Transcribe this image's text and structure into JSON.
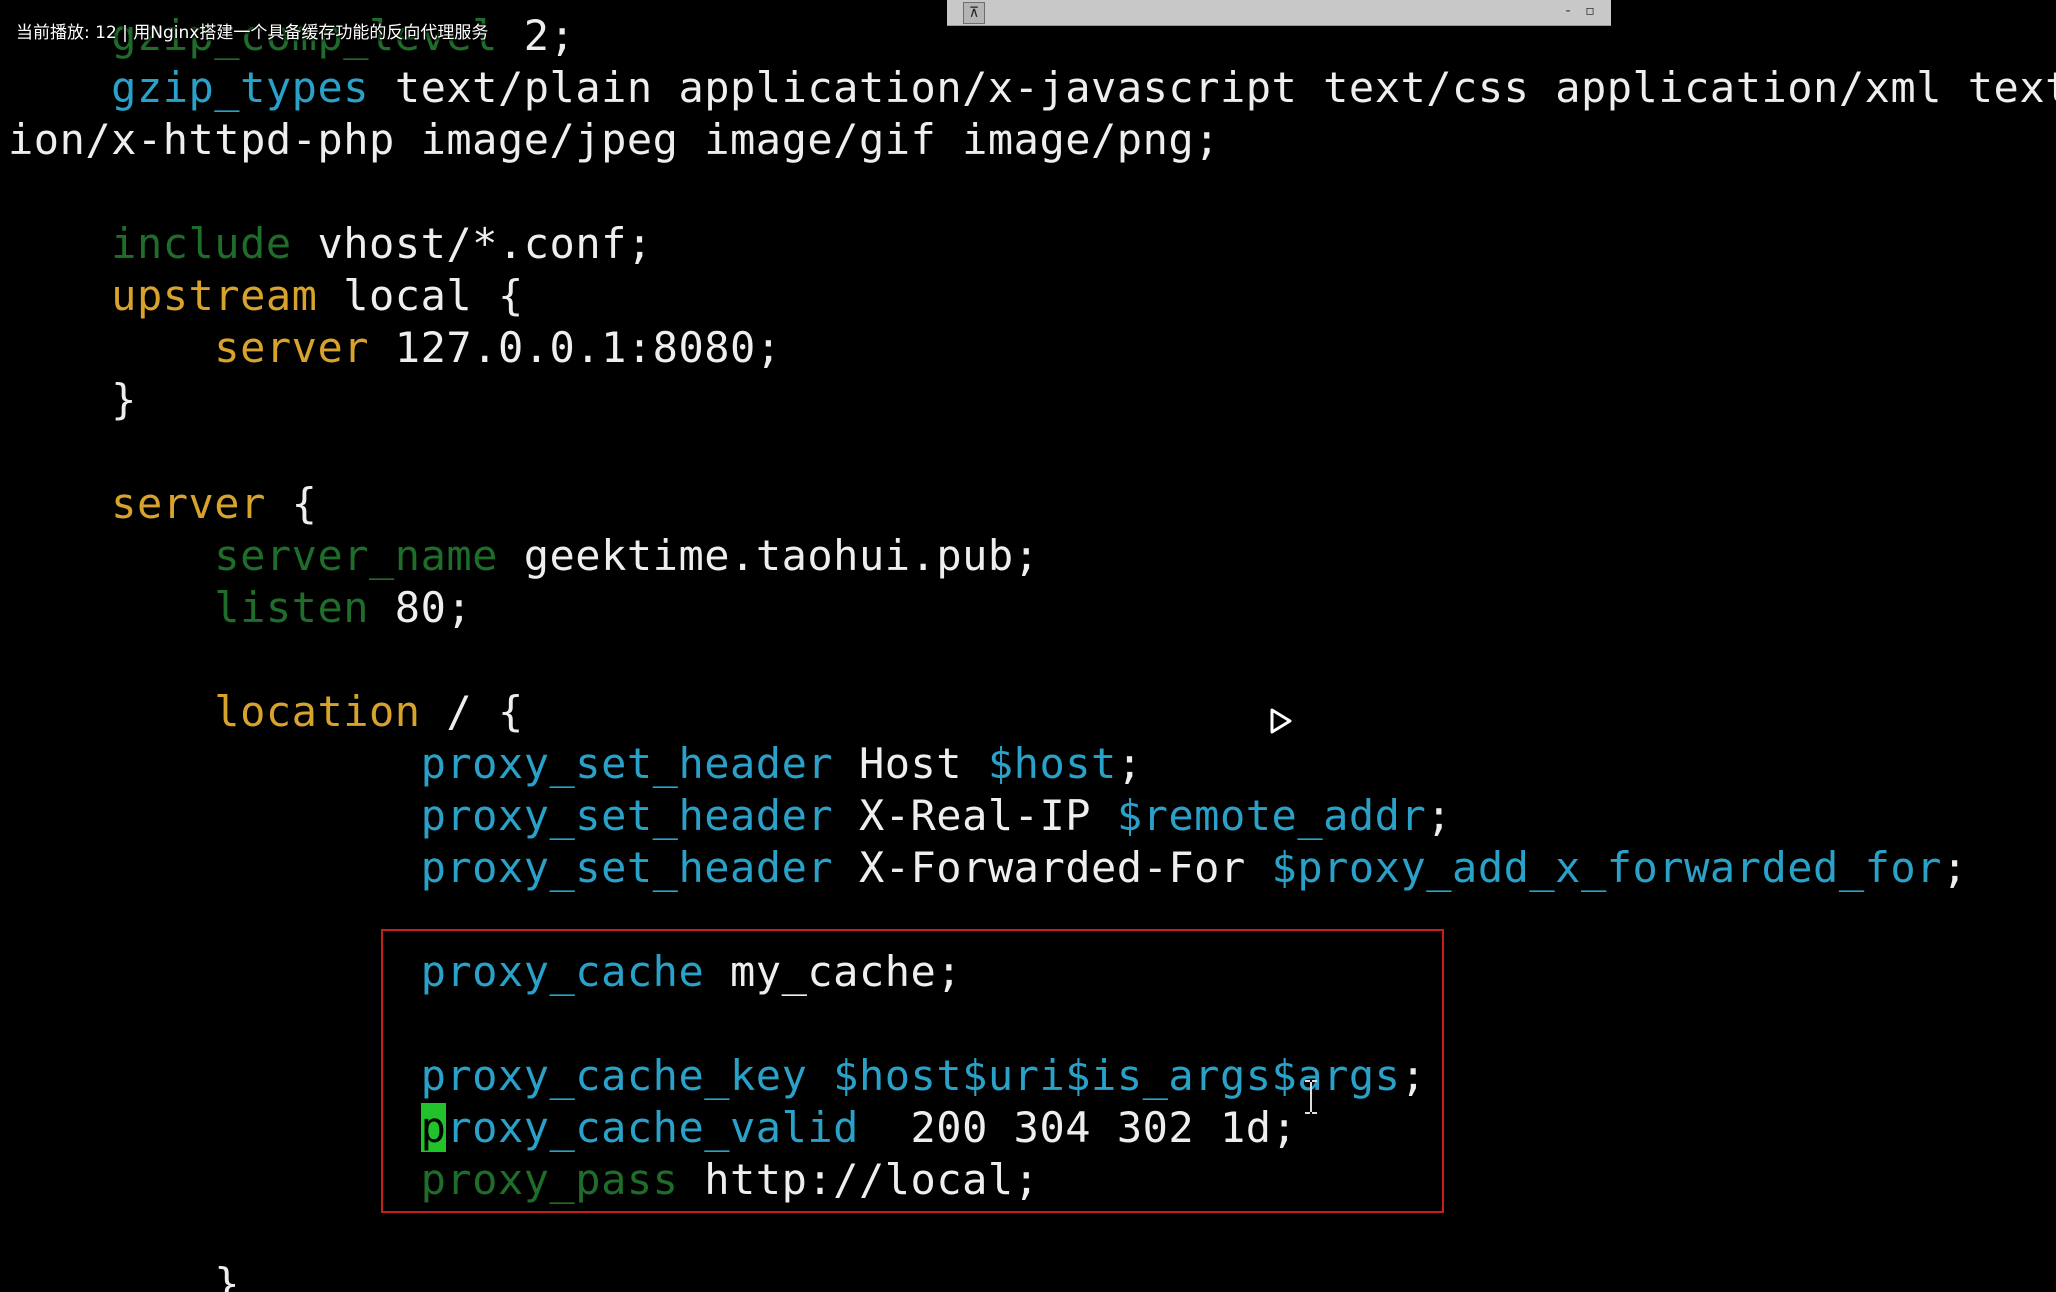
{
  "video_overlay": {
    "title": "当前播放: 12 | 用Nginx搭建一个具备缓存功能的反向代理服务"
  },
  "window_bar": {
    "pin_symbol": "⊼",
    "minimize_symbol": "-",
    "restore_symbol": "▫"
  },
  "colors": {
    "background": "#000000",
    "keyword_blue": "#2aa1c8",
    "keyword_yellow": "#d7a32c",
    "keyword_green_dim": "#1f6d2a",
    "text": "#eeeeee",
    "highlight_box": "#c81e1e",
    "cursor": "#22c22a"
  },
  "editor": {
    "lines": [
      [
        {
          "t": "    ",
          "c": "plain"
        },
        {
          "t": "gzip_comp_level",
          "c": "green"
        },
        {
          "t": " 2;",
          "c": "plain"
        }
      ],
      [
        {
          "t": "    ",
          "c": "plain"
        },
        {
          "t": "gzip_types",
          "c": "blue"
        },
        {
          "t": " text/plain application/x-javascript text/css application/xml text/",
          "c": "plain"
        }
      ],
      [
        {
          "t": "ion/x-httpd-php image/jpeg image/gif image/png;",
          "c": "plain"
        }
      ],
      [],
      [
        {
          "t": "    ",
          "c": "plain"
        },
        {
          "t": "include",
          "c": "green"
        },
        {
          "t": " vhost/*.conf;",
          "c": "plain"
        }
      ],
      [
        {
          "t": "    ",
          "c": "plain"
        },
        {
          "t": "upstream",
          "c": "yellow"
        },
        {
          "t": " local {",
          "c": "plain"
        }
      ],
      [
        {
          "t": "        ",
          "c": "plain"
        },
        {
          "t": "server",
          "c": "yellow"
        },
        {
          "t": " 127.0.0.1:8080;",
          "c": "plain"
        }
      ],
      [
        {
          "t": "    }",
          "c": "plain"
        }
      ],
      [],
      [
        {
          "t": "    ",
          "c": "plain"
        },
        {
          "t": "server",
          "c": "yellow"
        },
        {
          "t": " {",
          "c": "plain"
        }
      ],
      [
        {
          "t": "        ",
          "c": "plain"
        },
        {
          "t": "server_name",
          "c": "green"
        },
        {
          "t": " geektime.taohui.pub;",
          "c": "plain"
        }
      ],
      [
        {
          "t": "        ",
          "c": "plain"
        },
        {
          "t": "listen",
          "c": "green"
        },
        {
          "t": " 80;",
          "c": "plain"
        }
      ],
      [],
      [
        {
          "t": "        ",
          "c": "plain"
        },
        {
          "t": "location",
          "c": "yellow"
        },
        {
          "t": " / {",
          "c": "plain"
        }
      ],
      [
        {
          "t": "                ",
          "c": "plain"
        },
        {
          "t": "proxy_set_header",
          "c": "blue"
        },
        {
          "t": " Host ",
          "c": "plain"
        },
        {
          "t": "$host",
          "c": "blue"
        },
        {
          "t": ";",
          "c": "plain"
        }
      ],
      [
        {
          "t": "                ",
          "c": "plain"
        },
        {
          "t": "proxy_set_header",
          "c": "blue"
        },
        {
          "t": " X-Real-IP ",
          "c": "plain"
        },
        {
          "t": "$remote_addr",
          "c": "blue"
        },
        {
          "t": ";",
          "c": "plain"
        }
      ],
      [
        {
          "t": "                ",
          "c": "plain"
        },
        {
          "t": "proxy_set_header",
          "c": "blue"
        },
        {
          "t": " X-Forwarded-For ",
          "c": "plain"
        },
        {
          "t": "$proxy_add_x_forwarded_for",
          "c": "blue"
        },
        {
          "t": ";",
          "c": "plain"
        }
      ],
      [],
      [
        {
          "t": "                ",
          "c": "plain"
        },
        {
          "t": "proxy_cache",
          "c": "blue"
        },
        {
          "t": " my_cache;",
          "c": "plain"
        }
      ],
      [],
      [
        {
          "t": "                ",
          "c": "plain"
        },
        {
          "t": "proxy_cache_key",
          "c": "blue"
        },
        {
          "t": " ",
          "c": "plain"
        },
        {
          "t": "$host$uri$is_args$args",
          "c": "blue"
        },
        {
          "t": ";",
          "c": "plain"
        }
      ],
      [
        {
          "t": "                ",
          "c": "plain"
        },
        {
          "t": "p",
          "c": "cursor"
        },
        {
          "t": "roxy_cache_valid",
          "c": "blue"
        },
        {
          "t": "  200 304 302 1d;",
          "c": "plain"
        }
      ],
      [
        {
          "t": "                ",
          "c": "plain"
        },
        {
          "t": "proxy_pass",
          "c": "green"
        },
        {
          "t": " http://local;",
          "c": "plain"
        }
      ],
      [],
      [
        {
          "t": "        }",
          "c": "plain"
        }
      ]
    ]
  },
  "icons": {
    "play": "play-triangle-icon",
    "text_cursor": "i-beam-cursor-icon"
  }
}
